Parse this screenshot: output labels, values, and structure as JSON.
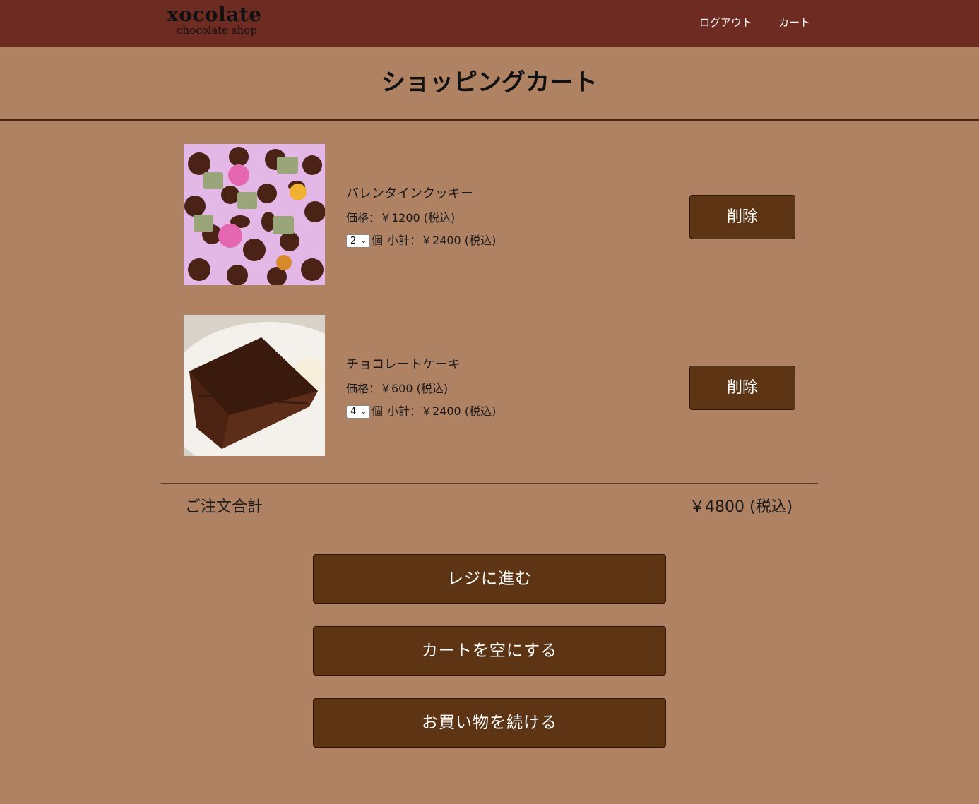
{
  "header": {
    "logo_main": "xocolate",
    "logo_sub": "chocolate shop",
    "nav": {
      "logout": "ログアウト",
      "cart": "カート"
    }
  },
  "page": {
    "title": "ショッピングカート"
  },
  "cart": {
    "items": [
      {
        "name": "バレンタインクッキー",
        "price": "価格：￥1200 (税込)",
        "qty": "2",
        "qty_unit": "個",
        "subtotal": "小計：￥2400 (税込)",
        "delete_label": "削除",
        "image": "cookies-photo"
      },
      {
        "name": "チョコレートケーキ",
        "price": "価格：￥600 (税込)",
        "qty": "4",
        "qty_unit": "個",
        "subtotal": "小計：￥2400 (税込)",
        "delete_label": "削除",
        "image": "chocolate-cake-photo"
      }
    ],
    "total_label": "ご注文合計",
    "total_value": "￥4800 (税込)"
  },
  "actions": {
    "checkout": "レジに進む",
    "empty_cart": "カートを空にする",
    "continue_shopping": "お買い物を続ける"
  },
  "colors": {
    "header_bg": "#6e2b22",
    "page_bg": "#b08264",
    "button_bg": "#5e3514"
  }
}
